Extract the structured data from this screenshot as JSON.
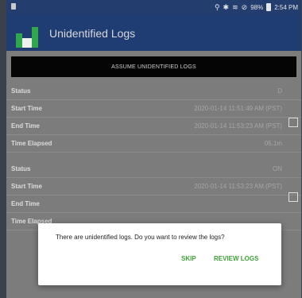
{
  "status_bar": {
    "time": "2:54 PM",
    "battery": "98%"
  },
  "app": {
    "title": "Unidentified Logs"
  },
  "assume_button": "ASSUME UNIDENTIFIED LOGS",
  "logs": [
    {
      "rows": [
        {
          "label": "Status",
          "value": "D"
        },
        {
          "label": "Start Time",
          "value": "2020-01-14 11:51:49 AM (PST)"
        },
        {
          "label": "End Time",
          "value": "2020-01-14 11:53:23 AM (PST)"
        },
        {
          "label": "Time Elapsed",
          "value": "05.1m"
        }
      ]
    },
    {
      "rows": [
        {
          "label": "Status",
          "value": "ON"
        },
        {
          "label": "Start Time",
          "value": "2020-01-14 11:53:23 AM (PST)"
        },
        {
          "label": "End Time",
          "value": ""
        },
        {
          "label": "Time Elapsed",
          "value": ""
        }
      ]
    }
  ],
  "dialog": {
    "message": "There are unidentified logs. Do you want to review the logs?",
    "skip": "SKIP",
    "review": "REVIEW LOGS"
  }
}
